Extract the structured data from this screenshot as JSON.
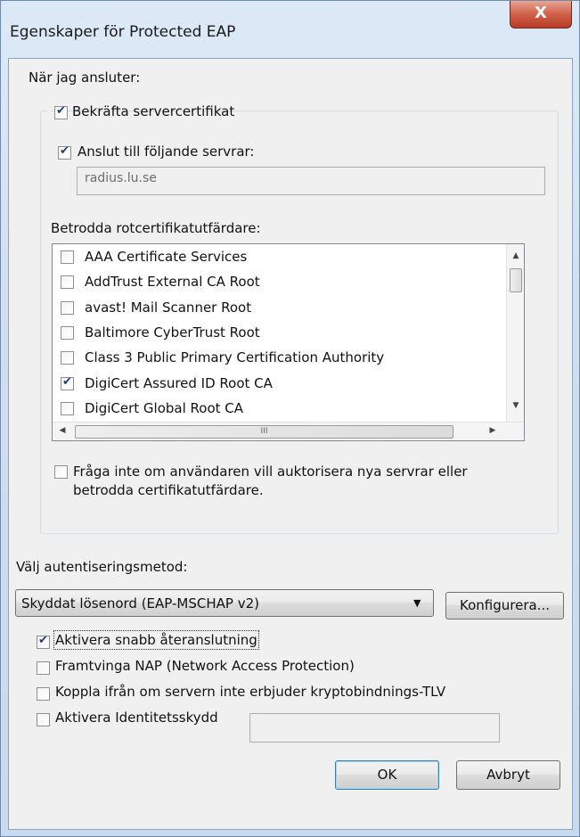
{
  "window": {
    "title": "Egenskaper för Protected EAP",
    "close_glyph": "X"
  },
  "connect": {
    "heading": "När jag ansluter:",
    "verify_cert_label": "Bekräfta servercertifikat",
    "verify_cert_checked": true,
    "connect_servers_label": "Anslut till följande servrar:",
    "connect_servers_checked": true,
    "servers_value": "radius.lu.se",
    "trusted_ca_heading": "Betrodda rotcertifikatutfärdare:",
    "ca_list": [
      {
        "label": "AAA Certificate Services",
        "checked": false
      },
      {
        "label": "AddTrust External CA Root",
        "checked": false
      },
      {
        "label": "avast! Mail Scanner Root",
        "checked": false
      },
      {
        "label": "Baltimore CyberTrust Root",
        "checked": false
      },
      {
        "label": "Class 3 Public Primary Certification Authority",
        "checked": false
      },
      {
        "label": "DigiCert Assured ID Root CA",
        "checked": true
      },
      {
        "label": "DigiCert Global Root CA",
        "checked": false
      }
    ],
    "hscroll_glyph": "III",
    "dont_prompt_label_line1": "Fråga inte om användaren vill auktorisera nya servrar eller",
    "dont_prompt_label_line2": "betrodda certifikatutfärdare.",
    "dont_prompt_checked": false
  },
  "auth": {
    "heading": "Välj autentiseringsmetod:",
    "method_selected": "Skyddat lösenord (EAP-MSCHAP v2)",
    "configure_label": "Konfigurera...",
    "options": [
      {
        "label": "Aktivera snabb återanslutning",
        "checked": true
      },
      {
        "label": "Framtvinga NAP (Network Access Protection)",
        "checked": false
      },
      {
        "label": "Koppla ifrån om servern inte erbjuder kryptobindnings-TLV",
        "checked": false
      },
      {
        "label": "Aktivera Identitetsskydd",
        "checked": false
      }
    ],
    "identity_value": ""
  },
  "buttons": {
    "ok_label": "OK",
    "cancel_label": "Avbryt"
  },
  "colors": {
    "title_gradient": "#dde9f6",
    "close_button": "#c8452d",
    "dialog_bg": "#f0f0f0",
    "check_mark": "#1d3d75"
  }
}
